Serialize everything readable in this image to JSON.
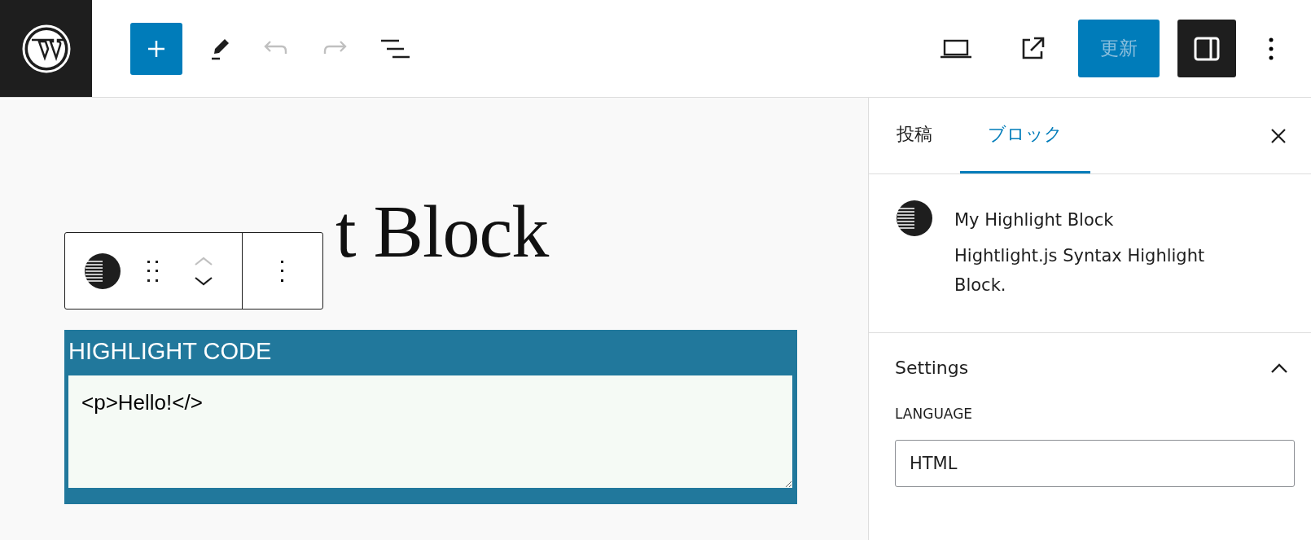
{
  "header": {
    "add_button": {
      "selected": false
    },
    "undo": {
      "disabled": true
    },
    "redo": {
      "disabled": true
    },
    "update_button": {
      "label": "更新",
      "disabled": true
    },
    "sidebar_toggle": {
      "on": true
    }
  },
  "editor": {
    "title": "t Block",
    "block": {
      "heading": "HIGHLIGHT CODE",
      "code": "<p>Hello!</>"
    }
  },
  "sidebar": {
    "tabs": [
      {
        "label": "投稿",
        "selected": false
      },
      {
        "label": "ブロック",
        "selected": true
      }
    ],
    "block_card": {
      "name": "My Highlight Block",
      "description": "Hightlight.js Syntax Highlight Block."
    },
    "settings": {
      "title": "Settings",
      "expanded": true,
      "language_label": "LANGUAGE",
      "language_value": "HTML"
    }
  }
}
